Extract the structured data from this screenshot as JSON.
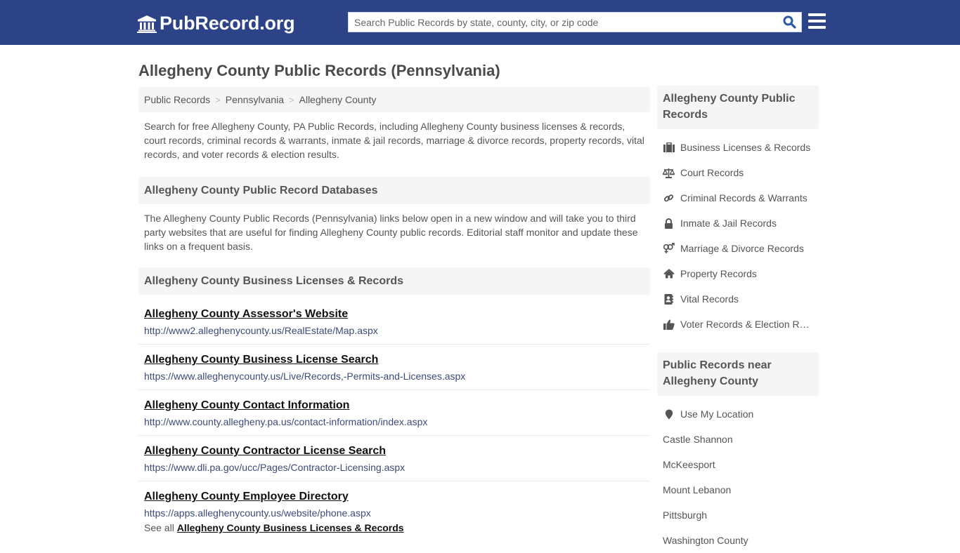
{
  "header": {
    "logo_text": "PubRecord.org",
    "search_placeholder": "Search Public Records by state, county, city, or zip code",
    "search_value": "",
    "brand_color": "#2d4388"
  },
  "page": {
    "title": "Allegheny County Public Records (Pennsylvania)"
  },
  "breadcrumb": [
    {
      "label": "Public Records"
    },
    {
      "label": "Pennsylvania"
    },
    {
      "label": "Allegheny County"
    }
  ],
  "breadcrumb_separator": ">",
  "intro": "Search for free Allegheny County, PA Public Records, including Allegheny County business licenses & records, court records, criminal records & warrants, inmate & jail records, marriage & divorce records, property records, vital records, and voter records & election results.",
  "databases": {
    "heading": "Allegheny County Public Record Databases",
    "text": "The Allegheny County Public Records (Pennsylvania) links below open in a new window and will take you to third party websites that are useful for finding Allegheny County public records. Editorial staff monitor and update these links on a frequent basis."
  },
  "business": {
    "heading": "Allegheny County Business Licenses & Records",
    "links": [
      {
        "title": "Allegheny County Assessor's Website",
        "url": "http://www2.alleghenycounty.us/RealEstate/Map.aspx"
      },
      {
        "title": "Allegheny County Business License Search",
        "url": "https://www.alleghenycounty.us/Live/Records,-Permits-and-Licenses.aspx"
      },
      {
        "title": "Allegheny County Contact Information",
        "url": "http://www.county.allegheny.pa.us/contact-information/index.aspx"
      },
      {
        "title": "Allegheny County Contractor License Search",
        "url": "https://www.dli.pa.gov/ucc/Pages/Contractor-Licensing.aspx"
      },
      {
        "title": "Allegheny County Employee Directory",
        "url": "https://apps.alleghenycounty.us/website/phone.aspx"
      }
    ],
    "see_all_prefix": "See all",
    "see_all_link": "Allegheny County Business Licenses & Records"
  },
  "sidebar": {
    "heading": "Allegheny County Public Records",
    "items": [
      {
        "label": "Business Licenses & Records",
        "icon": "briefcase-icon"
      },
      {
        "label": "Court Records",
        "icon": "balance-scale-icon"
      },
      {
        "label": "Criminal Records & Warrants",
        "icon": "link-icon"
      },
      {
        "label": "Inmate & Jail Records",
        "icon": "lock-icon"
      },
      {
        "label": "Marriage & Divorce Records",
        "icon": "venus-mars-icon"
      },
      {
        "label": "Property Records",
        "icon": "home-icon"
      },
      {
        "label": "Vital Records",
        "icon": "address-book-icon"
      },
      {
        "label": "Voter Records & Election Results",
        "icon": "thumbs-up-icon"
      }
    ]
  },
  "nearby": {
    "heading": "Public Records near Allegheny County",
    "use_location": "Use My Location",
    "places": [
      "Castle Shannon",
      "McKeesport",
      "Mount Lebanon",
      "Pittsburgh",
      "Washington County"
    ]
  }
}
